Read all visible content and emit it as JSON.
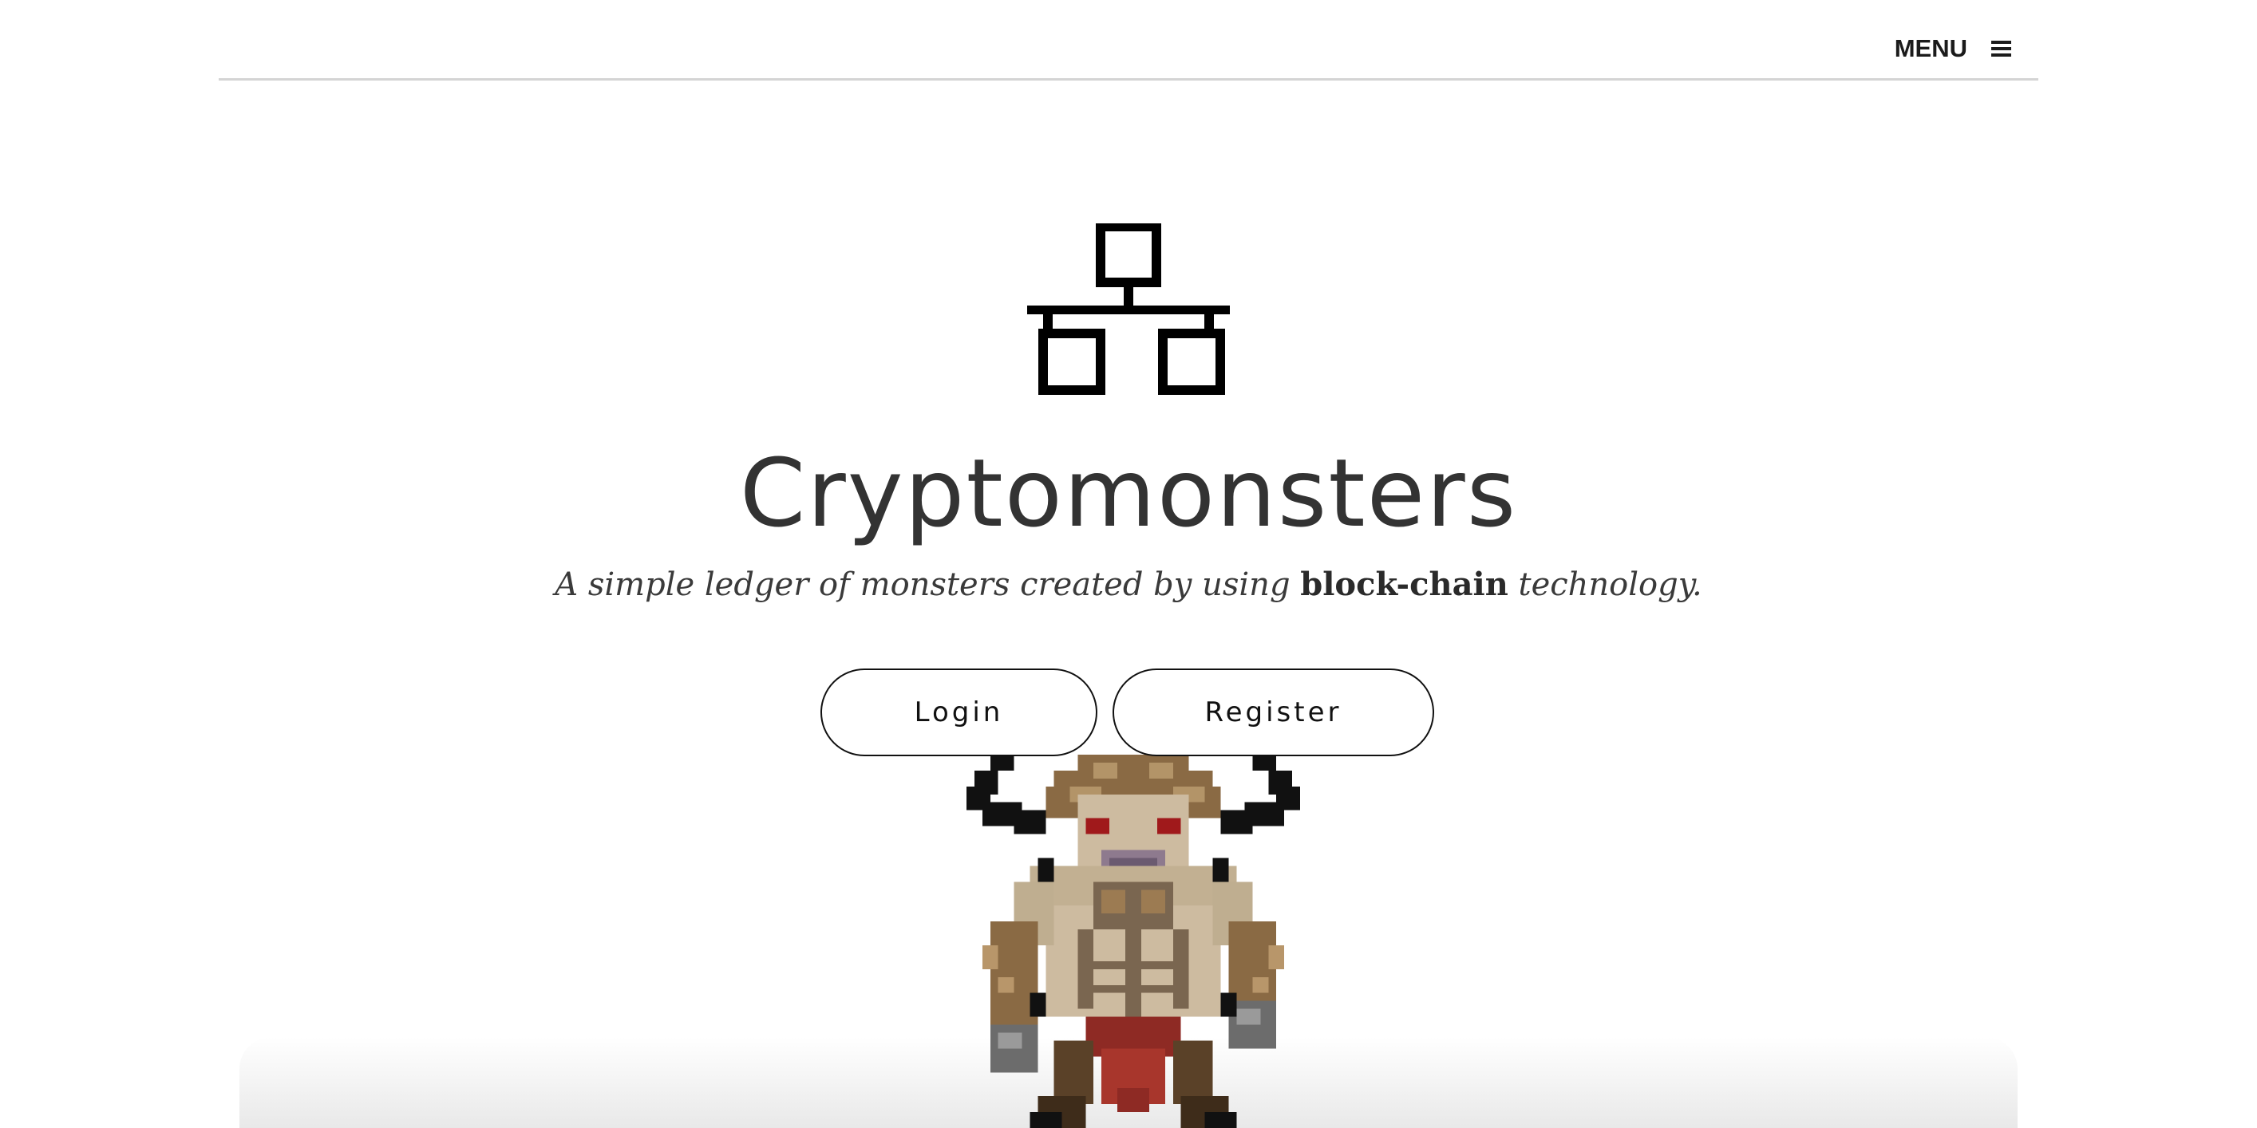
{
  "header": {
    "menu_label": "MENU",
    "menu_icon": "hamburger-icon"
  },
  "hero": {
    "logo_icon": "network-hierarchy-icon",
    "title": "Cryptomonsters",
    "subtitle_before": "A simple ledger of monsters created by using ",
    "subtitle_emphasis": "block-chain",
    "subtitle_after": " technology."
  },
  "actions": {
    "login_label": "Login",
    "register_label": "Register"
  },
  "illustration": {
    "subject": "pixel-art horned monster"
  },
  "colors": {
    "background": "#ffffff",
    "text_dark": "#333333",
    "rule": "#d4d4d4",
    "monster_skin": "#c9b79a",
    "monster_fur": "#8a6a44",
    "monster_loincloth": "#8e2a24"
  }
}
